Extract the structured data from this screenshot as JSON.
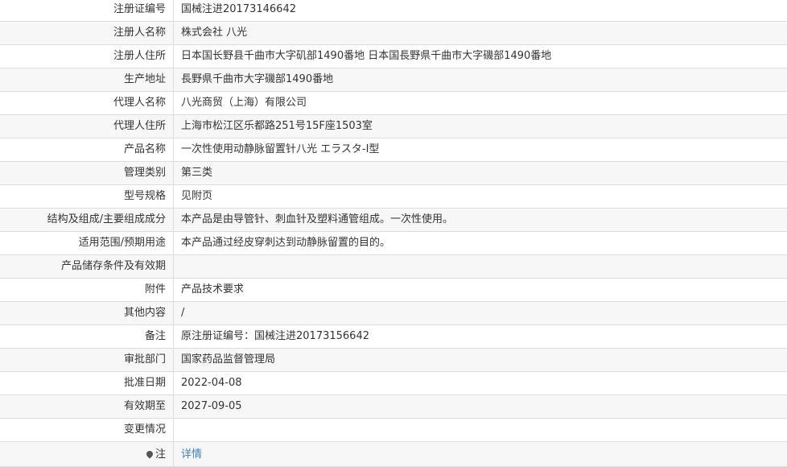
{
  "rows": [
    {
      "label": "注册证编号",
      "value": "国械注进20173146642"
    },
    {
      "label": "注册人名称",
      "value": "株式会社 八光"
    },
    {
      "label": "注册人住所",
      "value": "日本国长野县千曲市大字矶部1490番地 日本国長野県千曲市大字磯部1490番地"
    },
    {
      "label": "生产地址",
      "value": "長野県千曲市大字磯部1490番地"
    },
    {
      "label": "代理人名称",
      "value": "八光商贸（上海）有限公司"
    },
    {
      "label": "代理人住所",
      "value": "上海市松江区乐都路251号15F座1503室"
    },
    {
      "label": "产品名称",
      "value": "一次性使用动静脉留置针八光 エラスタ-Ⅰ型"
    },
    {
      "label": "管理类别",
      "value": "第三类"
    },
    {
      "label": "型号规格",
      "value": "见附页"
    },
    {
      "label": "结构及组成/主要组成成分",
      "value": "本产品是由导管针、刺血针及塑料通管组成。一次性使用。"
    },
    {
      "label": "适用范围/预期用途",
      "value": "本产品通过经皮穿刺达到动静脉留置的目的。"
    },
    {
      "label": "产品储存条件及有效期",
      "value": ""
    },
    {
      "label": "附件",
      "value": "产品技术要求"
    },
    {
      "label": "其他内容",
      "value": "/"
    },
    {
      "label": "备注",
      "value": "原注册证编号：国械注进20173156642"
    },
    {
      "label": "审批部门",
      "value": "国家药品监督管理局"
    },
    {
      "label": "批准日期",
      "value": "2022-04-08"
    },
    {
      "label": "有效期至",
      "value": "2027-09-05"
    },
    {
      "label": "变更情况",
      "value": ""
    }
  ],
  "note": {
    "label": "注",
    "link": "详情",
    "icon": "map-pin-icon",
    "link_color": "#3a7fc1"
  }
}
